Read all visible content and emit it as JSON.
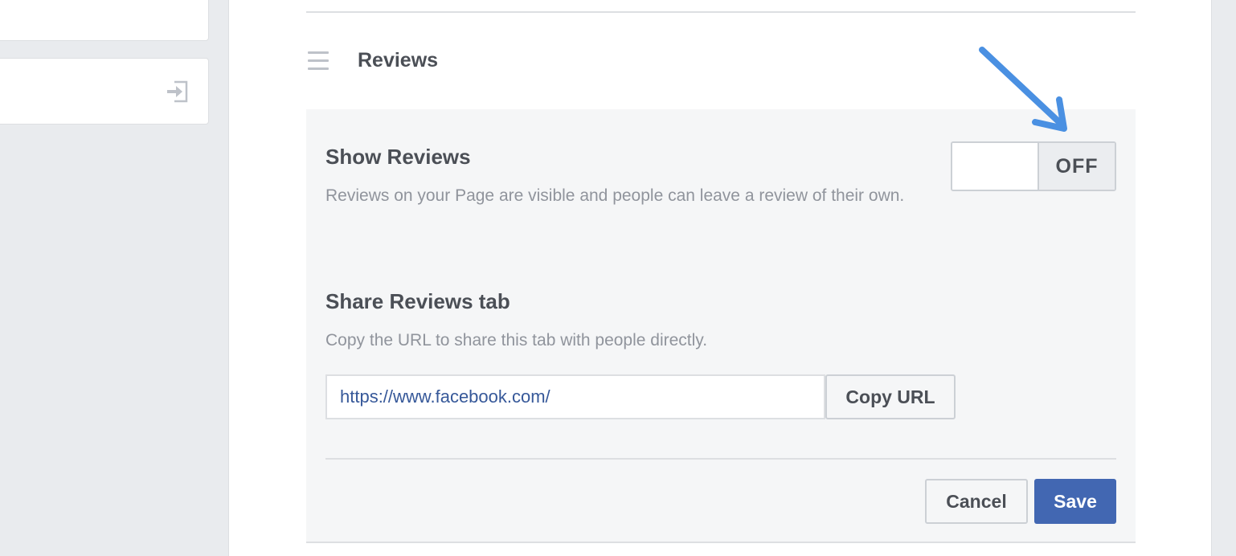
{
  "section": {
    "title": "Reviews",
    "drag_icon": "hamburger-icon"
  },
  "left_column": {
    "exit_icon": "exit-icon"
  },
  "show_reviews": {
    "label": "Show Reviews",
    "description": "Reviews on your Page are visible and people can leave a review of their own.",
    "toggle_state": "OFF"
  },
  "share": {
    "label": "Share Reviews tab",
    "description": "Copy the URL to share this tab with people directly.",
    "url_value": "https://www.facebook.com/",
    "copy_button": "Copy URL"
  },
  "footer": {
    "cancel": "Cancel",
    "save": "Save"
  },
  "annotation": {
    "type": "arrow",
    "color": "#4a90e2"
  },
  "colors": {
    "primary": "#4267b2",
    "link": "#365899",
    "text": "#4b4f56",
    "muted": "#90949c"
  }
}
